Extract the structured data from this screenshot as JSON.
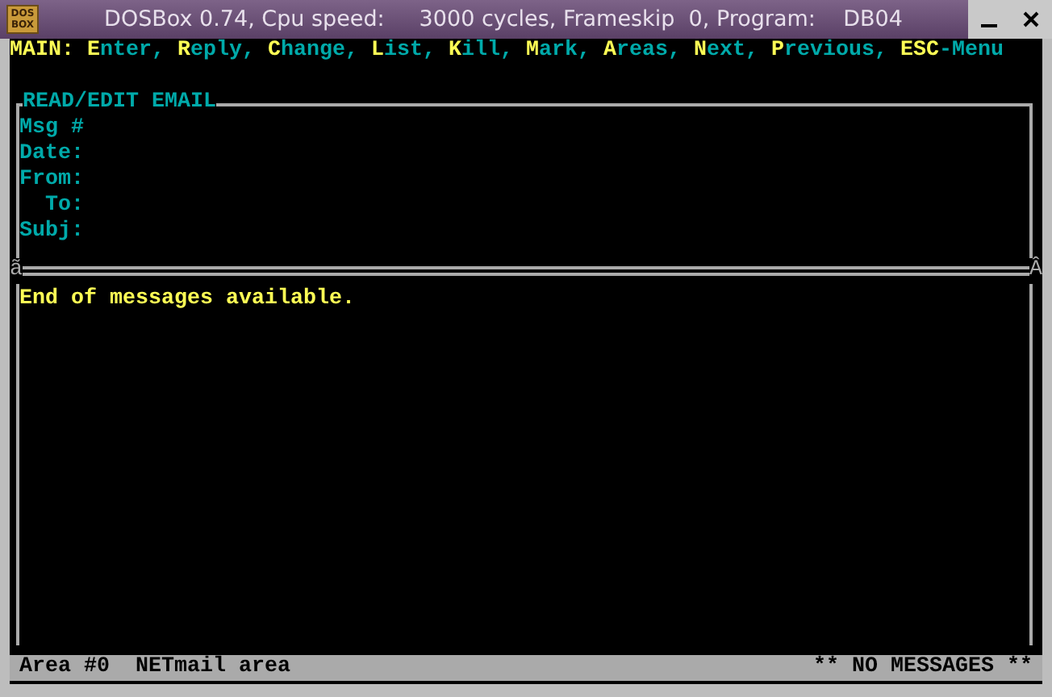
{
  "window": {
    "title": "DOSBox 0.74, Cpu speed:     3000 cycles, Frameskip  0, Program:    DB04",
    "icon_lines": [
      "DOS",
      "BOX"
    ]
  },
  "menu": {
    "label": "MAIN:",
    "items": [
      {
        "key": "E",
        "rest": "nter,"
      },
      {
        "key": "R",
        "rest": "eply,"
      },
      {
        "key": "C",
        "rest": "hange,"
      },
      {
        "key": "L",
        "rest": "ist,"
      },
      {
        "key": "K",
        "rest": "ill,"
      },
      {
        "key": "M",
        "rest": "ark,"
      },
      {
        "key": "A",
        "rest": "reas,"
      },
      {
        "key": "N",
        "rest": "ext,"
      },
      {
        "key": "P",
        "rest": "revious,"
      },
      {
        "key": "ESC",
        "rest": "-Menu"
      }
    ]
  },
  "header": {
    "title": "READ/EDIT EMAIL",
    "fields": [
      "Msg #",
      "Date:",
      "From:",
      "  To:",
      "Subj:"
    ],
    "divider_left": "ã",
    "divider_right": "Â"
  },
  "message": "End of messages available.",
  "status_bar": {
    "area": "Area #0",
    "area_name": "NETmail area",
    "notice": "** NO MESSAGES **"
  }
}
